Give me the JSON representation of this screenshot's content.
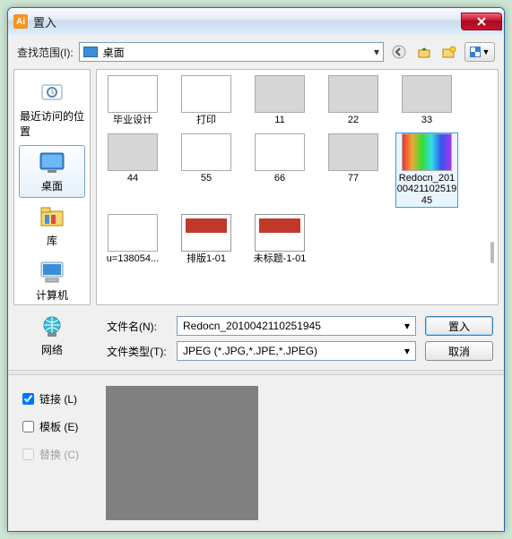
{
  "window": {
    "title": "置入",
    "app_badge": "Ai"
  },
  "lookin": {
    "label": "查找范围(I):",
    "value": "桌面"
  },
  "toolbar": {
    "back": "back-icon",
    "up": "up-level-icon",
    "newfolder": "new-folder-icon",
    "viewmenu": "view-menu"
  },
  "places": [
    {
      "label": "最近访问的位置",
      "key": "recent"
    },
    {
      "label": "桌面",
      "key": "desktop",
      "selected": true
    },
    {
      "label": "库",
      "key": "libraries"
    },
    {
      "label": "计算机",
      "key": "computer"
    },
    {
      "label": "网络",
      "key": "network"
    }
  ],
  "files": [
    {
      "label": "毕业设计",
      "thumb": "white"
    },
    {
      "label": "打印",
      "thumb": "white"
    },
    {
      "label": "11",
      "thumb": "gray"
    },
    {
      "label": "22",
      "thumb": "gray"
    },
    {
      "label": "33",
      "thumb": "gray"
    },
    {
      "label": "44",
      "thumb": "gray"
    },
    {
      "label": "55",
      "thumb": "white"
    },
    {
      "label": "66",
      "thumb": "white"
    },
    {
      "label": "77",
      "thumb": "gray"
    },
    {
      "label": "Redocn_2010042110251945",
      "thumb": "rainbow",
      "selected": true
    },
    {
      "label": "u=138054...",
      "thumb": "white"
    },
    {
      "label": "排版1-01",
      "thumb": "doc"
    },
    {
      "label": "未标题-1-01",
      "thumb": "doc"
    }
  ],
  "filename": {
    "label": "文件名(N):",
    "value": "Redocn_2010042110251945"
  },
  "filetype": {
    "label": "文件类型(T):",
    "value": "JPEG (*.JPG,*.JPE,*.JPEG)"
  },
  "buttons": {
    "place": "置入",
    "cancel": "取消"
  },
  "options": {
    "link": {
      "label": "链接 (L)",
      "checked": true,
      "enabled": true
    },
    "template": {
      "label": "模板 (E)",
      "checked": false,
      "enabled": true
    },
    "replace": {
      "label": "替换 (C)",
      "checked": false,
      "enabled": false
    }
  }
}
